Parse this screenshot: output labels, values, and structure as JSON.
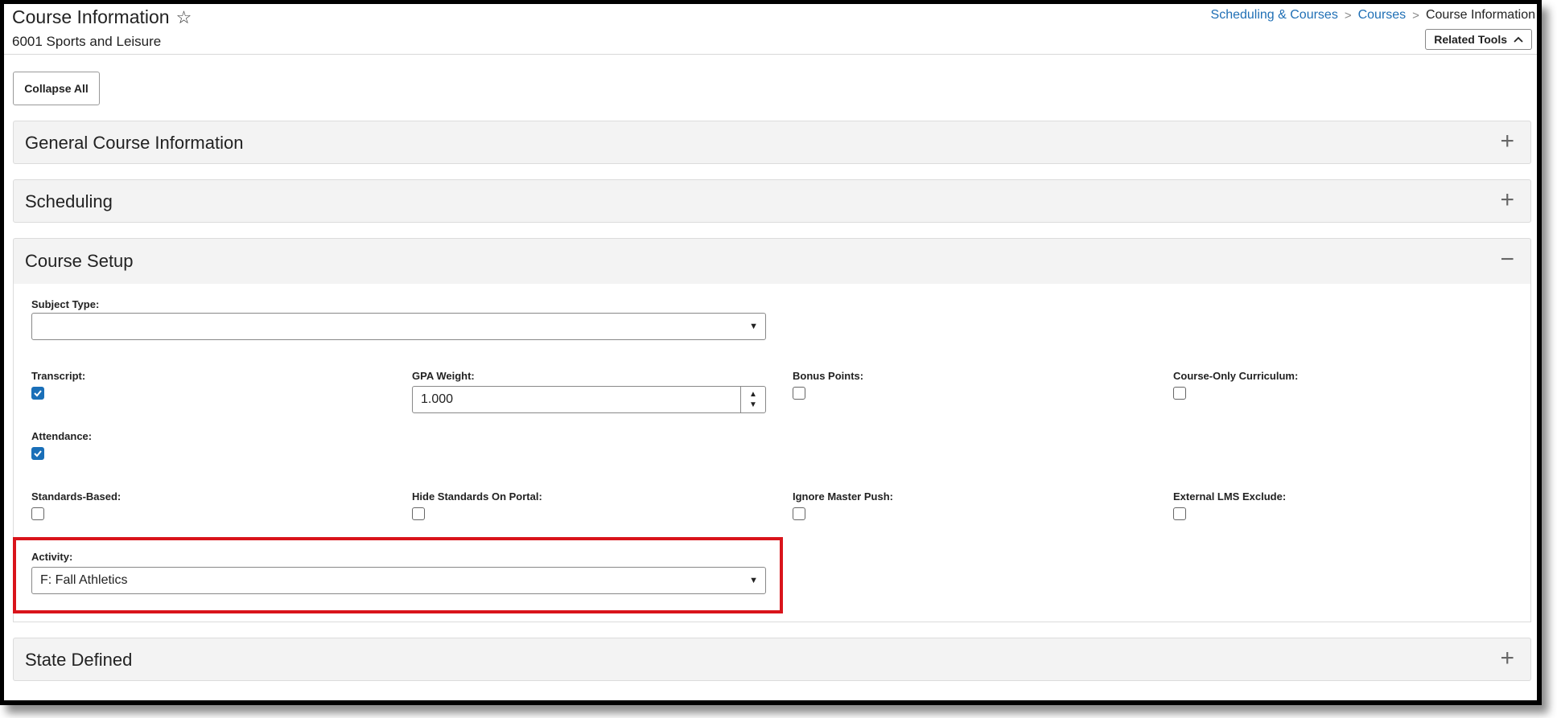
{
  "header": {
    "title": "Course Information",
    "subtitle": "6001 Sports and Leisure",
    "breadcrumb": [
      "Scheduling & Courses",
      "Courses",
      "Course Information"
    ],
    "related_tools": "Related Tools"
  },
  "toolbar": {
    "collapse_all": "Collapse All"
  },
  "sections": {
    "general": {
      "title": "General Course Information",
      "toggle": "+"
    },
    "scheduling": {
      "title": "Scheduling",
      "toggle": "+"
    },
    "course_setup": {
      "title": "Course Setup",
      "toggle": "−"
    },
    "state_defined": {
      "title": "State Defined",
      "toggle": "+"
    }
  },
  "course_setup": {
    "subject_type": {
      "label": "Subject Type:",
      "value": ""
    },
    "transcript": {
      "label": "Transcript:",
      "checked": true
    },
    "gpa_weight": {
      "label": "GPA Weight:",
      "value": "1.000"
    },
    "bonus_points": {
      "label": "Bonus Points:",
      "checked": false
    },
    "course_only_curriculum": {
      "label": "Course-Only Curriculum:",
      "checked": false
    },
    "attendance": {
      "label": "Attendance:",
      "checked": true
    },
    "standards_based": {
      "label": "Standards-Based:",
      "checked": false
    },
    "hide_standards_on_portal": {
      "label": "Hide Standards On Portal:",
      "checked": false
    },
    "ignore_master_push": {
      "label": "Ignore Master Push:",
      "checked": false
    },
    "external_lms_exclude": {
      "label": "External LMS Exclude:",
      "checked": false
    },
    "activity": {
      "label": "Activity:",
      "value": "F: Fall Athletics"
    }
  },
  "colors": {
    "link": "#1f6fb5",
    "check": "#1a6fb8",
    "highlight": "#d9141b"
  }
}
